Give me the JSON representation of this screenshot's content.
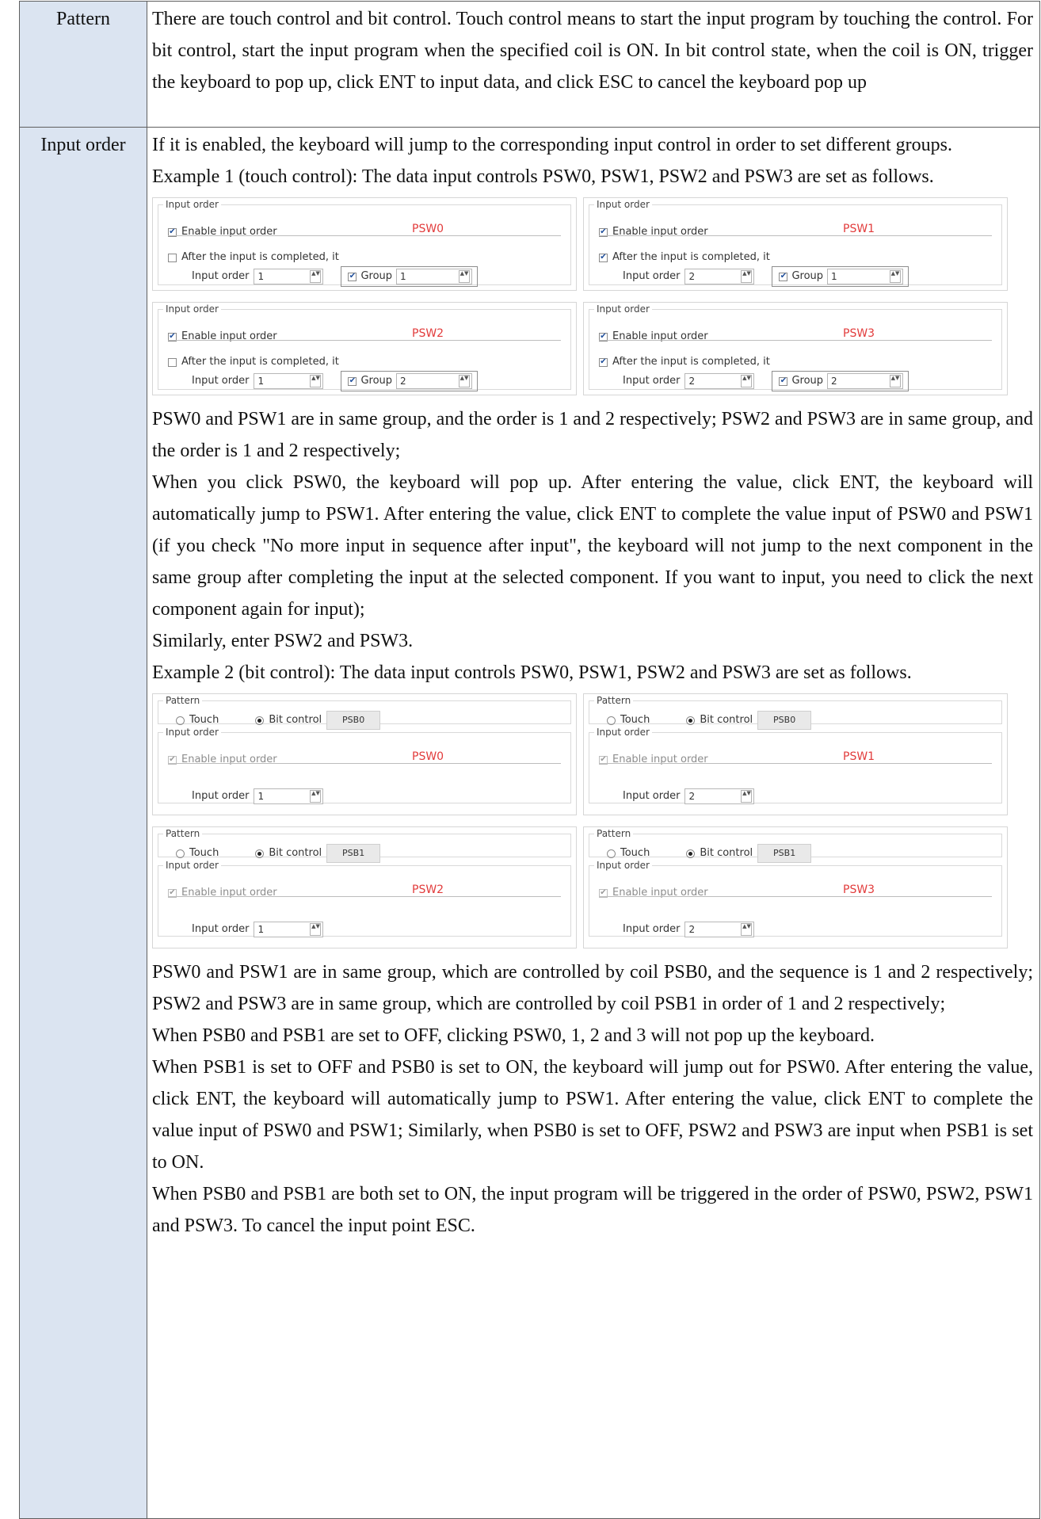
{
  "rows": {
    "pattern": {
      "label": "Pattern",
      "text": "There are touch control and bit control. Touch control means to start the input program by touching the control. For bit control, start the input program when the specified coil is ON. In bit control state, when the coil is ON, trigger the keyboard to pop up, click ENT to input data, and click ESC to cancel the keyboard pop up"
    },
    "input_order": {
      "label": "Input order",
      "intro": "If it is enabled, the keyboard will jump to the corresponding input control in order to set different groups.",
      "example1_heading": "Example 1 (touch control): The data input controls PSW0, PSW1, PSW2 and PSW3 are set as follows.",
      "example1_text_1": "PSW0 and PSW1 are in same group, and the order is 1 and 2 respectively; PSW2 and PSW3 are in same group, and the order is 1 and 2 respectively;",
      "example1_text_2": "When you click PSW0, the keyboard will pop up. After entering the value, click ENT, the keyboard will automatically jump to PSW1. After entering the value, click ENT to complete the value input of PSW0 and PSW1 (if you check \"No more input in sequence after input\", the keyboard will not jump to the next component in the same group after completing the input at the selected component. If you want to input, you need to click the next component again for input);",
      "example1_text_3": "Similarly, enter PSW2 and PSW3.",
      "example2_heading": "Example 2 (bit control): The data input controls PSW0, PSW1, PSW2 and PSW3 are set as follows.",
      "example2_text_1": "PSW0 and PSW1 are in same group, which are controlled by coil PSB0, and the sequence is 1 and 2 respectively; PSW2 and PSW3 are in same group, which are controlled by coil PSB1 in order of 1 and 2 respectively;",
      "example2_text_2": "When PSB0 and PSB1 are set to OFF, clicking PSW0, 1, 2 and 3 will not pop up the keyboard.",
      "example2_text_3": "When PSB1 is set to OFF and PSB0 is set to ON, the keyboard will jump out for PSW0. After entering the value, click ENT, the keyboard will automatically jump to PSW1. After entering the value, click ENT to complete the value input of PSW0 and PSW1; Similarly, when PSB0 is set to OFF, PSW2 and PSW3 are input when PSB1 is set to ON.",
      "example2_text_4": "When PSB0 and PSB1 are both set to ON, the input program will be triggered in the order of PSW0, PSW2, PSW1 and PSW3. To cancel the input point ESC."
    }
  },
  "ui": {
    "input_order_title": "Input order",
    "enable_input_order": "Enable input order",
    "after_completed": "After the input is completed, it",
    "input_order_label": "Input order",
    "group_label": "Group",
    "pattern_title": "Pattern",
    "touch_label": "Touch",
    "bit_control_label": "Bit control"
  },
  "example1_panels": [
    {
      "psw": "PSW0",
      "enable_checked": true,
      "after_checked": false,
      "order": "1",
      "group_checked": true,
      "group": "1"
    },
    {
      "psw": "PSW1",
      "enable_checked": true,
      "after_checked": true,
      "order": "2",
      "group_checked": true,
      "group": "1"
    },
    {
      "psw": "PSW2",
      "enable_checked": true,
      "after_checked": false,
      "order": "1",
      "group_checked": true,
      "group": "2"
    },
    {
      "psw": "PSW3",
      "enable_checked": true,
      "after_checked": true,
      "order": "2",
      "group_checked": true,
      "group": "2"
    }
  ],
  "example2_panels": [
    {
      "psw": "PSW0",
      "coil": "PSB0",
      "order": "1"
    },
    {
      "psw": "PSW1",
      "coil": "PSB0",
      "order": "2"
    },
    {
      "psw": "PSW2",
      "coil": "PSB1",
      "order": "1"
    },
    {
      "psw": "PSW3",
      "coil": "PSB1",
      "order": "2"
    }
  ],
  "colors": {
    "label_bg": "#dbe4f1",
    "psw_red": "#e23b3b"
  }
}
